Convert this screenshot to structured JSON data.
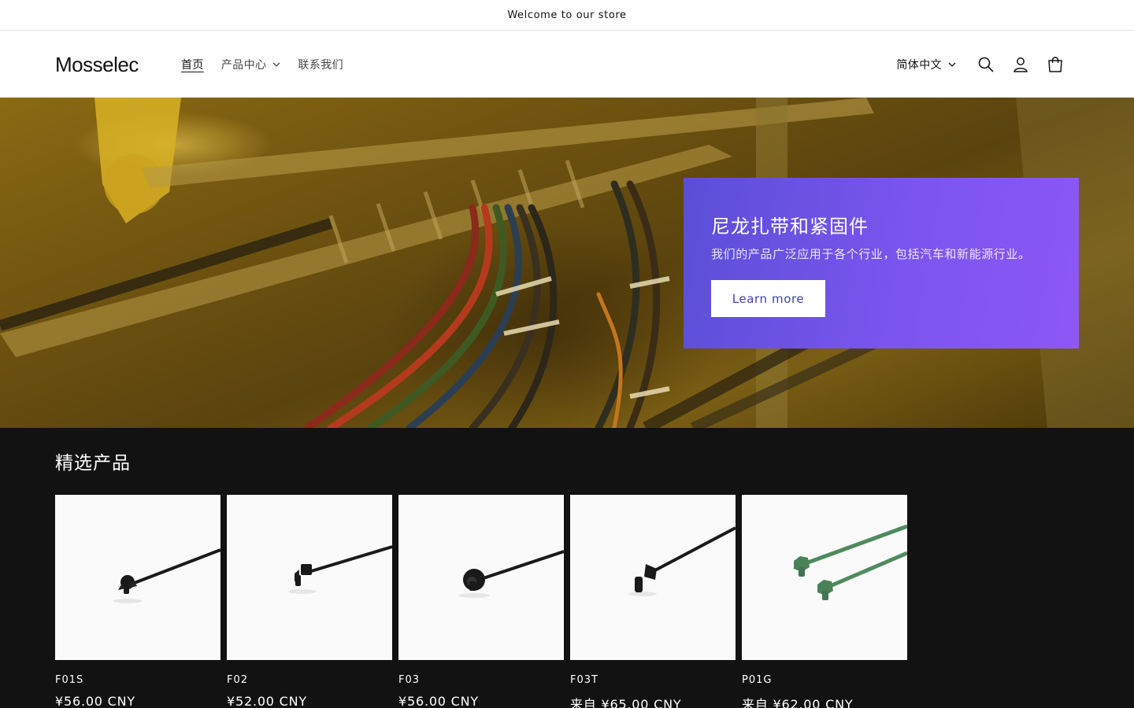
{
  "announcement": {
    "text": "Welcome to our store"
  },
  "header": {
    "logo": "Mosselec",
    "nav": [
      {
        "label": "首页",
        "active": true
      },
      {
        "label": "产品中心",
        "has_dropdown": true
      },
      {
        "label": "联系我们"
      }
    ],
    "language": "简体中文",
    "icons": [
      "search-icon",
      "account-icon",
      "cart-icon"
    ]
  },
  "hero": {
    "title": "尼龙扎带和紧固件",
    "subtitle": "我们的产品广泛应用于各个行业，包括汽车和新能源行业。",
    "button": "Learn more",
    "accent_colors": [
      "#5a4fd6",
      "#8e57f5"
    ]
  },
  "featured": {
    "title": "精选产品",
    "products": [
      {
        "name": "F01S",
        "price": "¥56.00 CNY",
        "color": "#1a1a1a"
      },
      {
        "name": "F02",
        "price": "¥52.00 CNY",
        "color": "#1a1a1a"
      },
      {
        "name": "F03",
        "price": "¥56.00 CNY",
        "color": "#1a1a1a"
      },
      {
        "name": "F03T",
        "price": "来自 ¥65.00 CNY",
        "color": "#1a1a1a"
      },
      {
        "name": "P01G",
        "price": "来自 ¥62.00 CNY",
        "color": "#4f8a5e"
      }
    ]
  }
}
